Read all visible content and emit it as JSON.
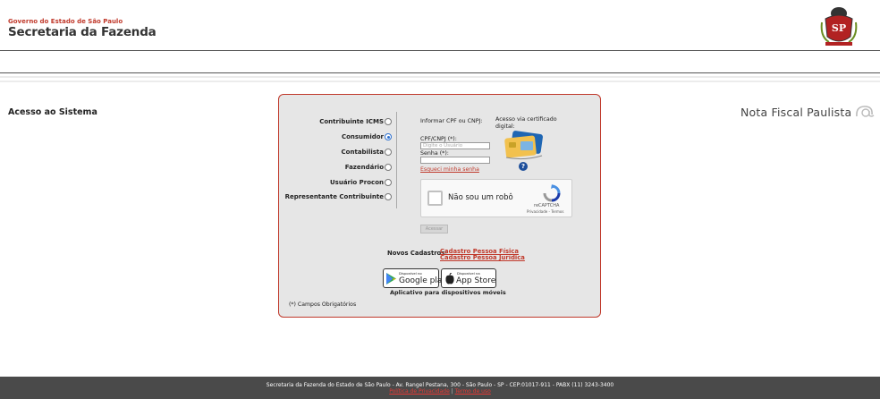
{
  "header": {
    "gov_line": "Governo do Estado de São Paulo",
    "department": "Secretaria da Fazenda",
    "logo_icon": "sp-coat-of-arms-icon",
    "logo_text": "SP"
  },
  "subheader": {
    "access_title": "Acesso ao Sistema",
    "app_title": "Nota Fiscal Paulista",
    "app_logo_icon": "nfp-logo-icon"
  },
  "profiles": [
    {
      "label": "Contribuinte ICMS",
      "checked": false
    },
    {
      "label": "Consumidor",
      "checked": true
    },
    {
      "label": "Contabilista",
      "checked": false
    },
    {
      "label": "Fazendário",
      "checked": false
    },
    {
      "label": "Usuário Procon",
      "checked": false
    },
    {
      "label": "Representante Contribuinte",
      "checked": false
    }
  ],
  "login": {
    "inform_label": "Informar CPF ou CNPJ:",
    "cpf_label": "CPF/CNPJ (*):",
    "cpf_placeholder": "Digite o Usuário",
    "password_label": "Senha (*):",
    "forgot_password": "Esqueci minha senha",
    "access_button": "Acessar"
  },
  "certificate": {
    "text": "Acesso via certificado digital:",
    "icon": "certificate-card-icon",
    "help_icon": "help-icon",
    "help_glyph": "?"
  },
  "captcha": {
    "label": "Não sou um robô",
    "brand": "reCAPTCHA",
    "privacy": "Privacidade",
    "separator": "-",
    "terms": "Termos"
  },
  "new_registration": {
    "label": "Novos Cadastros:",
    "individual": "Cadastro Pessoa Física",
    "company": "Cadastro Pessoa Jurídica"
  },
  "apps": {
    "google_small": "Disponível no",
    "google_big": "Google play",
    "apple_small": "Disponível na",
    "apple_big": "App Store",
    "caption": "Aplicativo para dispositivos móveis"
  },
  "required_note": "(*) Campos Obrigatórios",
  "footer": {
    "address": "Secretaria da Fazenda do Estado de São Paulo - Av. Rangel Pestana, 300 - São Paulo - SP - CEP:01017-911 - PABX (11) 3243-3400",
    "privacy_link": "Política de Privacidade",
    "separator": "|",
    "terms_link": "Termo de uso"
  },
  "colors": {
    "accent_red": "#c0392b",
    "panel_bg": "#e6e6e6",
    "footer_bg": "#4a4a4a",
    "help_blue": "#1e4f9b"
  }
}
